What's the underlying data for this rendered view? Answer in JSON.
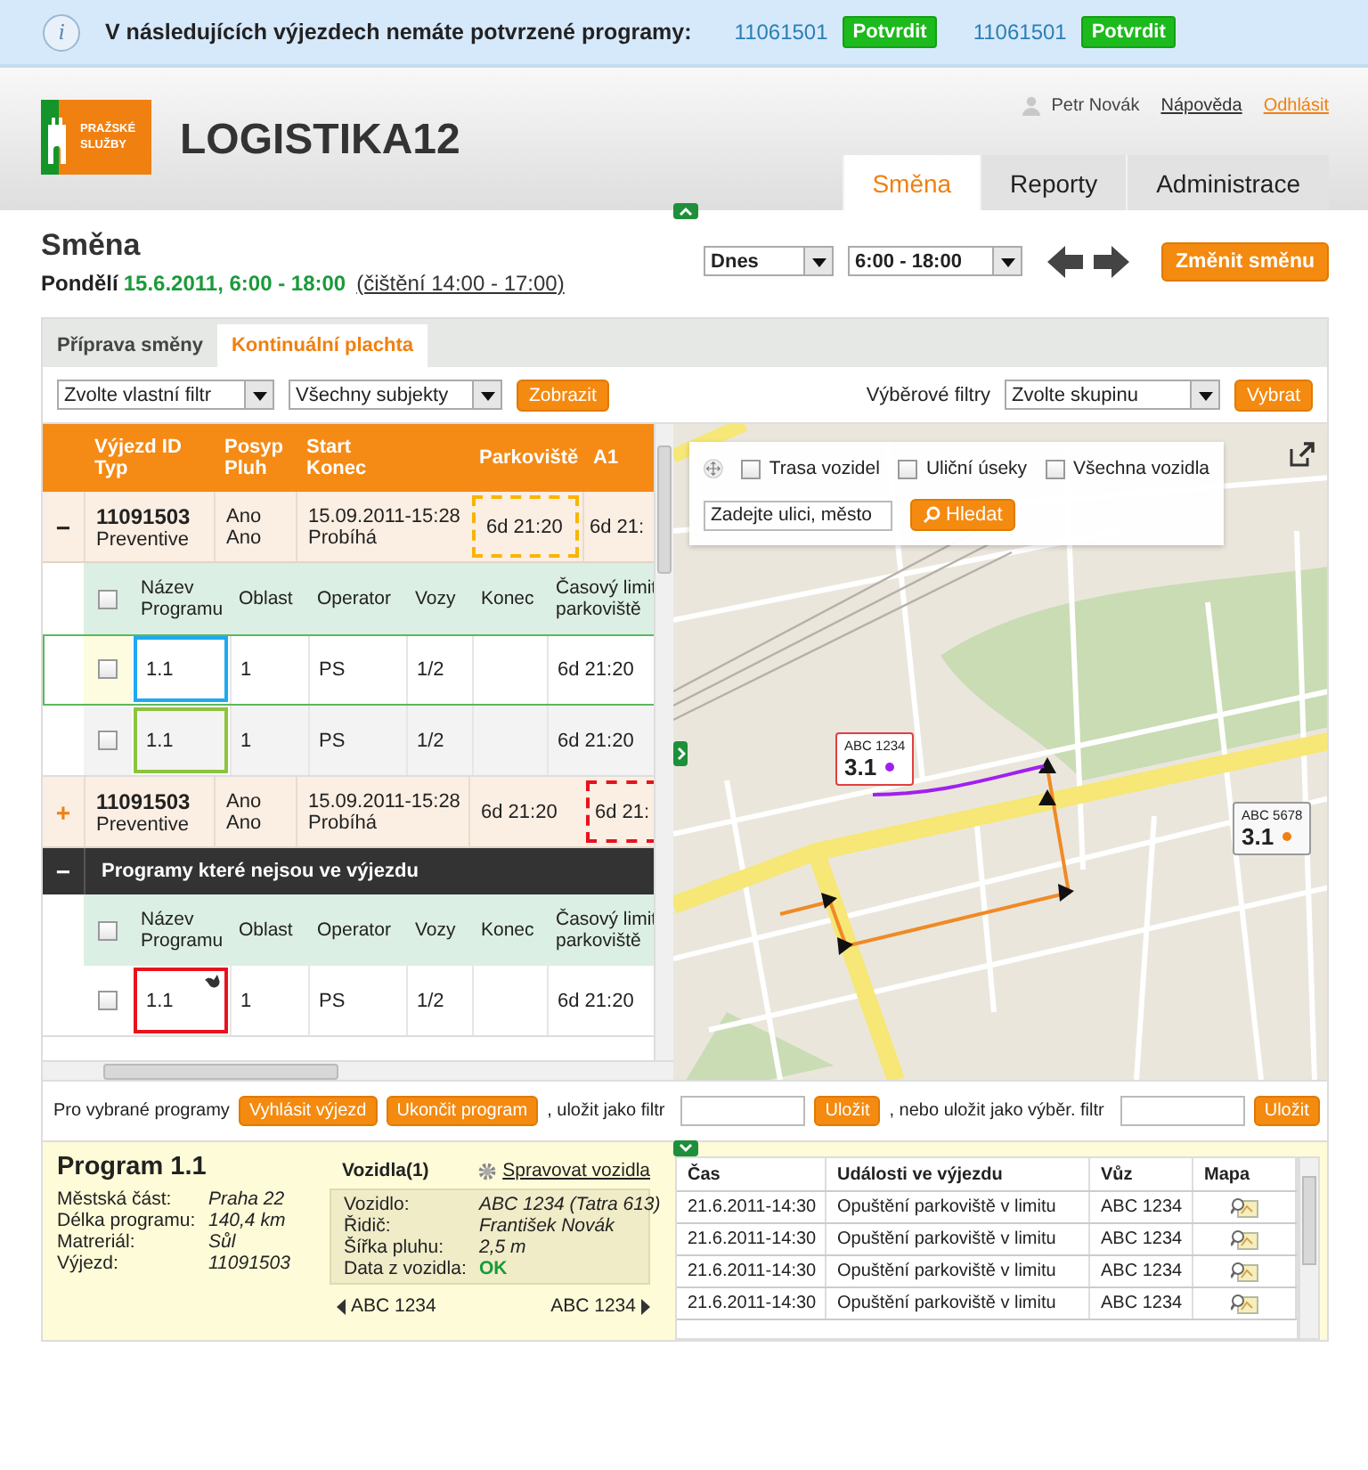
{
  "notice": {
    "icon": "i",
    "text": "V následujících výjezdech nemáte potvrzené programy:",
    "items": [
      {
        "id": "11061501",
        "button": "Potvrdit"
      },
      {
        "id": "11061501",
        "button": "Potvrdit"
      }
    ]
  },
  "header": {
    "logo_lines": [
      "PRAŽSKÉ",
      "SLUŽBY"
    ],
    "app_name": "LOGISTIKA12",
    "user": "Petr Novák",
    "help": "Nápověda",
    "logout": "Odhlásit",
    "tabs": [
      {
        "label": "Směna",
        "selected": true
      },
      {
        "label": "Reporty",
        "selected": false
      },
      {
        "label": "Administrace",
        "selected": false
      }
    ]
  },
  "shift": {
    "expanded": true,
    "title": "Směna",
    "day": "Pondělí",
    "date": "15.6.2011, 6:00 - 18:00",
    "cleaning": "(čištění 14:00 - 17:00)",
    "day_select": "Dnes",
    "time_select": "6:00 - 18:00",
    "change_button": "Změnit směnu"
  },
  "panel_tabs": [
    {
      "label": "Příprava směny",
      "selected": false
    },
    {
      "label": "Kontinuální plachta",
      "selected": true
    }
  ],
  "filters": {
    "custom_filter": "Zvolte vlastní filtr",
    "subjects": "Všechny subjekty",
    "show_button": "Zobrazit",
    "group_label": "Výběrové filtry",
    "group_select": "Zvolte skupinu",
    "select_button": "Vybrat"
  },
  "table": {
    "columns": [
      [
        "Výjezd ID",
        "Typ"
      ],
      [
        "Posyp",
        "Pluh"
      ],
      [
        "Start",
        "Konec"
      ],
      [
        "Parkoviště"
      ],
      [
        "A1"
      ]
    ],
    "rows": [
      {
        "kind": "trip",
        "toggle": "−",
        "expanded": true,
        "id": "11091503",
        "type": "Preventive",
        "posyp": "Ano",
        "pluh": "Ano",
        "start": "15.09.2011-15:28",
        "end": "Probíhá",
        "parking": "6d 21:20",
        "a1": "6d 21:",
        "parking_warning": true,
        "a1_alert": false
      },
      {
        "kind": "subheader",
        "checked": false,
        "columns": [
          "Název Programu",
          "Oblast",
          "Operator",
          "Vozy",
          "Konec",
          "Časový limit parkoviště"
        ]
      },
      {
        "kind": "program",
        "checked": false,
        "selected": true,
        "shaded": false,
        "name": "1.1",
        "color": "#1eaaf0",
        "marker": false,
        "area": "1",
        "operator": "PS",
        "cars": "1/2",
        "limit": "6d 21:20"
      },
      {
        "kind": "program",
        "checked": false,
        "selected": false,
        "shaded": true,
        "name": "1.1",
        "color": "#8cc43c",
        "marker": false,
        "area": "1",
        "operator": "PS",
        "cars": "1/2",
        "limit": "6d 21:20"
      },
      {
        "kind": "trip",
        "toggle": "+",
        "expanded": false,
        "id": "11091503",
        "type": "Preventive",
        "posyp": "Ano",
        "pluh": "Ano",
        "start": "15.09.2011-15:28",
        "end": "Probíhá",
        "parking": "6d 21:20",
        "a1": "6d 21:",
        "parking_warning": false,
        "a1_alert": true
      },
      {
        "kind": "group",
        "toggle": "−",
        "expanded": true,
        "label": "Programy které nejsou ve výjezdu"
      },
      {
        "kind": "subheader",
        "checked": false,
        "columns": [
          "Název Programu",
          "Oblast",
          "Operator",
          "Vozy",
          "Konec",
          "Časový limit parkoviště"
        ]
      },
      {
        "kind": "program",
        "checked": false,
        "selected": false,
        "shaded": false,
        "name": "1.1",
        "color": "#e8121e",
        "marker": true,
        "area": "1",
        "operator": "PS",
        "cars": "1/2",
        "limit": "6d 21:20"
      }
    ]
  },
  "map": {
    "options": [
      {
        "label": "Trasa vozidel",
        "checked": false
      },
      {
        "label": "Uliční úseky",
        "checked": false
      },
      {
        "label": "Všechna vozidla",
        "checked": false
      }
    ],
    "search_placeholder": "Zadejte ulici, město",
    "search_button": "Hledat",
    "markers": [
      {
        "label": "ABC 1234",
        "value": "3.1",
        "color": "#a020f0",
        "kind": "active"
      },
      {
        "label": "ABC 5678",
        "value": "3.1",
        "color": "#f08010",
        "kind": "idle"
      }
    ]
  },
  "actions": {
    "label": "Pro vybrané programy",
    "buttons": [
      "Vyhlásit výjezd",
      "Ukončit program"
    ],
    "save_filter_label": ", uložit jako filtr",
    "save_button": "Uložit",
    "save_group_label": ", nebo uložit jako výběr. filtr",
    "save_group_button": "Uložit"
  },
  "detail": {
    "expanded": true,
    "title": "Program 1.1",
    "fields": [
      {
        "label": "Městská část:",
        "value": "Praha 22"
      },
      {
        "label": "Délka programu:",
        "value": "140,4 km"
      },
      {
        "label": "Matreriál:",
        "value": "Sůl"
      },
      {
        "label": "Výjezd:",
        "value": "11091503"
      }
    ],
    "vehicles": {
      "title": "Vozidla(1)",
      "manage": "Spravovat vozidla",
      "fields": [
        {
          "label": "Vozidlo:",
          "value": "ABC 1234 (Tatra 613)",
          "kind": "plain"
        },
        {
          "label": "Řidič:",
          "value": "František Novák",
          "kind": "plain"
        },
        {
          "label": "Šířka pluhu:",
          "value": "2,5 m",
          "kind": "plain"
        },
        {
          "label": "Data z vozidla:",
          "value": "OK",
          "kind": "status"
        }
      ],
      "prev": "ABC 1234",
      "next": "ABC 1234"
    }
  },
  "events": {
    "columns": [
      "Čas",
      "Události ve výjezdu",
      "Vůz",
      "Mapa"
    ],
    "rows": [
      {
        "time": "21.6.2011-14:30",
        "event": "Opuštění parkoviště v limitu",
        "vehicle": "ABC 1234"
      },
      {
        "time": "21.6.2011-14:30",
        "event": "Opuštění parkoviště v limitu",
        "vehicle": "ABC 1234"
      },
      {
        "time": "21.6.2011-14:30",
        "event": "Opuštění parkoviště v limitu",
        "vehicle": "ABC 1234"
      },
      {
        "time": "21.6.2011-14:30",
        "event": "Opuštění parkoviště v limitu",
        "vehicle": "ABC 1234"
      }
    ]
  }
}
